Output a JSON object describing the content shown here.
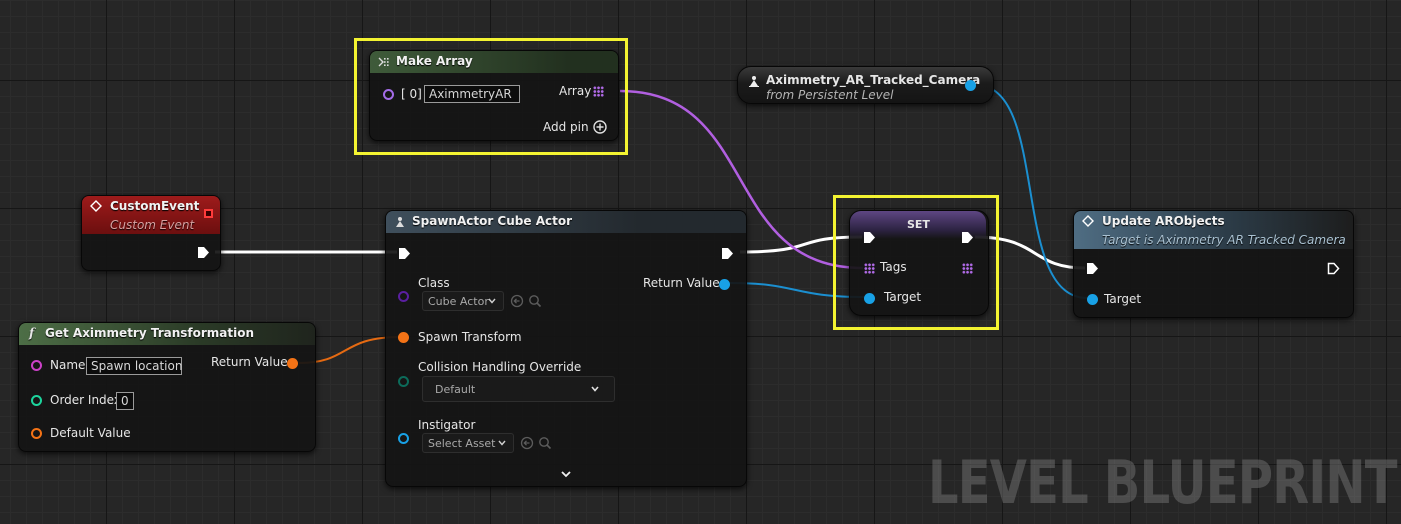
{
  "watermark": "LEVEL BLUEPRINT",
  "colors": {
    "object_pin": "#a46ce8",
    "struct_pin": "#f47316",
    "target_pin": "#18a1e6",
    "name_pin": "#cc41c8",
    "int_pin": "#1dd49d",
    "highlight": "#f3f331",
    "event_header": "#8d1515",
    "function_header": "#4d6e46",
    "set_header": "#6f4f9a",
    "update_header": "#4d6b80"
  },
  "nodes": {
    "make_array": {
      "title": "Make Array",
      "icon": "make-array-icon",
      "element_label": "[ 0]",
      "element_value": "AximmetryAR",
      "array_label": "Array",
      "add_pin_label": "Add pin"
    },
    "camera_ref": {
      "title": "Aximmetry_AR_Tracked_Camera",
      "subtitle": "from Persistent Level"
    },
    "custom_event": {
      "title": "CustomEvent",
      "subtitle": "Custom Event"
    },
    "spawn_actor": {
      "title": "SpawnActor Cube Actor",
      "class_label": "Class",
      "class_value": "Cube Actor",
      "return_label": "Return Value",
      "transform_label": "Spawn Transform",
      "collision_label": "Collision Handling Override",
      "collision_value": "Default",
      "instigator_label": "Instigator",
      "instigator_value": "Select Asset"
    },
    "set_node": {
      "title": "SET",
      "tags_label": "Tags",
      "target_label": "Target"
    },
    "update": {
      "title": "Update ARObjects",
      "subtitle": "Target is Aximmetry AR Tracked Camera",
      "target_label": "Target"
    },
    "get_transform": {
      "title": "Get Aximmetry Transformation",
      "icon_glyph": "f",
      "name_label": "Name",
      "name_value": "Spawn location",
      "return_label": "Return Value",
      "order_label": "Order Index",
      "order_value": "0",
      "default_label": "Default Value"
    }
  }
}
